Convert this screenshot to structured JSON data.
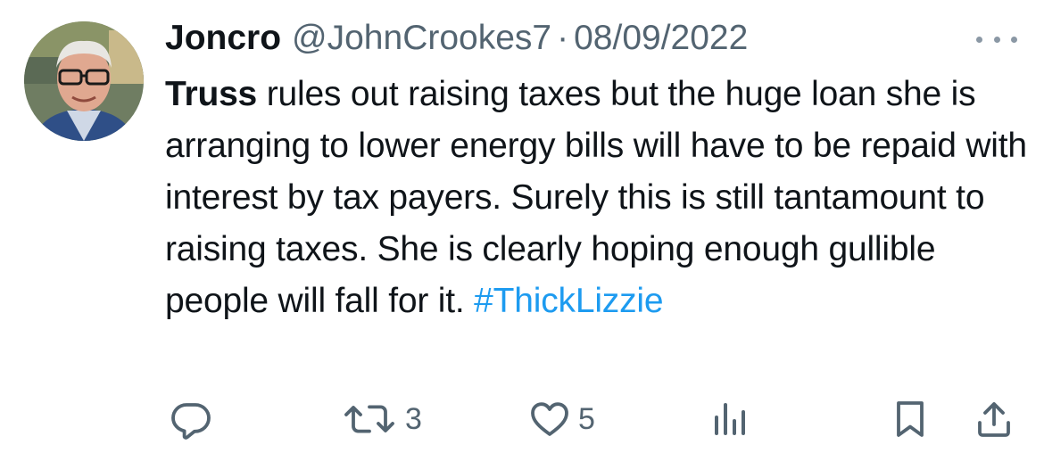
{
  "tweet": {
    "author_name": "Joncro",
    "handle": "@JohnCrookes7",
    "separator": "·",
    "date": "08/09/2022",
    "text_bold": "Truss",
    "text_main": " rules out raising taxes but the huge loan she is arranging to lower energy bills will have to be repaid with interest by tax payers. Surely this is still tantamount to raising taxes. She is clearly hoping enough gullible people will fall for it. ",
    "hashtag": "#ThickLizzie",
    "retweet_count": "3",
    "like_count": "5"
  },
  "icons": {
    "reply": "reply-icon",
    "retweet": "retweet-icon",
    "like": "heart-icon",
    "views": "analytics-icon",
    "bookmark": "bookmark-icon",
    "share": "share-icon",
    "more": "more-options-icon"
  },
  "colors": {
    "text": "#0f1419",
    "secondary": "#536471",
    "link": "#1d9bf0",
    "background": "#ffffff"
  }
}
